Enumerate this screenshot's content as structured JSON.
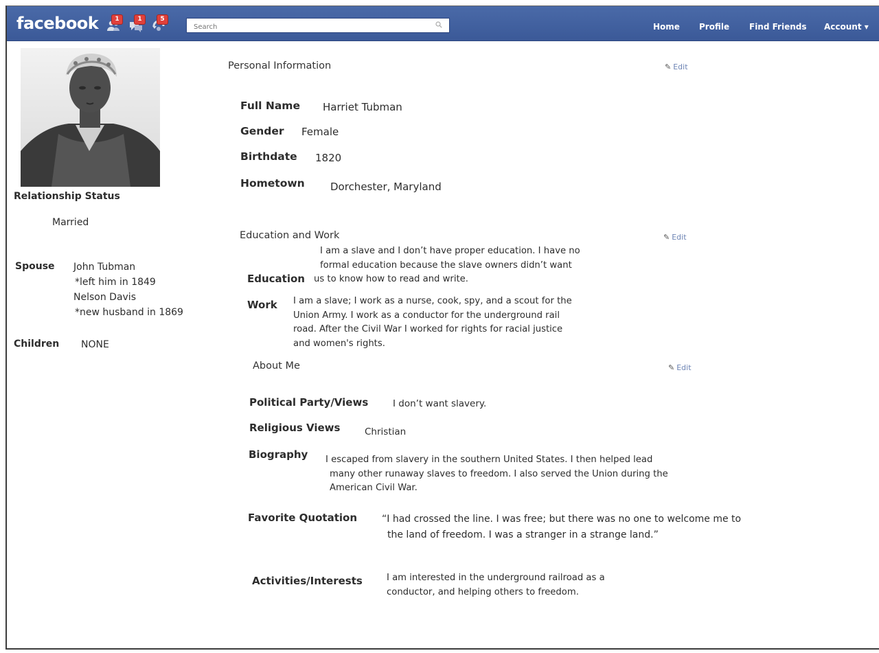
{
  "header": {
    "logo": "facebook",
    "badges": {
      "friend_requests": "1",
      "messages": "1",
      "notifications": "5"
    },
    "search_placeholder": "Search",
    "nav": [
      "Home",
      "Profile",
      "Find Friends",
      "Account ▾"
    ],
    "color": "#3b5998"
  },
  "left": {
    "relationship_label": "Relationship Status",
    "relationship_value": "Married",
    "spouse_label": "Spouse",
    "spouse_lines": [
      "John Tubman",
      "*left him in 1849",
      "Nelson Davis",
      "*new husband in 1869"
    ],
    "children_label": "Children",
    "children_value": "NONE"
  },
  "personal": {
    "title": "Personal Information",
    "edit": "Edit",
    "full_name_label": "Full Name",
    "full_name": "Harriet Tubman",
    "gender_label": "Gender",
    "gender": "Female",
    "birthdate_label": "Birthdate",
    "birthdate": "1820",
    "hometown_label": "Hometown",
    "hometown": "Dorchester, Maryland"
  },
  "education_work": {
    "title": "Education and Work",
    "edit": "Edit",
    "education_label": "Education",
    "education_lines": [
      "I am a slave and I don’t have proper education. I have no",
      "formal education because the slave owners didn’t want",
      "us to know how to read and write."
    ],
    "work_label": "Work",
    "work_lines": [
      "I am a slave; I work as a nurse, cook, spy, and a scout for the",
      "Union Army. I work as a conductor for the underground rail",
      "road. After the Civil War I worked for rights for racial justice",
      "and women's rights."
    ]
  },
  "about": {
    "title": "About Me",
    "edit": "Edit",
    "political_label": "Political Party/Views",
    "political": "I don’t want slavery.",
    "religious_label": "Religious Views",
    "religious": "Christian",
    "biography_label": "Biography",
    "biography_lines": [
      "I escaped from slavery in the southern United States. I then helped lead",
      "many other runaway slaves to freedom. I also served the Union during the",
      "American Civil War."
    ],
    "quote_label": "Favorite Quotation",
    "quote_lines": [
      "“I had crossed the line. I was free; but there was no one to welcome me to",
      "the land of freedom. I was a stranger in a strange land.”"
    ],
    "activities_label": "Activities/Interests",
    "activities_lines": [
      "I am interested in the underground railroad as a",
      "conductor, and helping others to freedom."
    ]
  }
}
